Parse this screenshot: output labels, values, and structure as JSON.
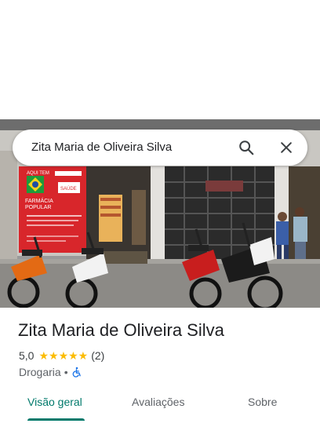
{
  "search": {
    "query": "Zita Maria de Oliveira Silva"
  },
  "place": {
    "name": "Zita Maria de Oliveira Silva",
    "rating": "5,0",
    "stars": "★★★★★",
    "review_count": "(2)",
    "category": "Drogaria",
    "separator": "•"
  },
  "photo_signs": {
    "line1": "AQUI TEM",
    "line2": "FARMÁCIA",
    "line3": "POPULAR",
    "badge": "SAÚDE"
  },
  "tabs": [
    {
      "label": "Visão geral",
      "active": true
    },
    {
      "label": "Avaliações",
      "active": false
    },
    {
      "label": "Sobre",
      "active": false
    }
  ],
  "colors": {
    "accent": "#00796b",
    "star": "#fbbc04",
    "accessibility": "#1a73e8"
  },
  "icons": {
    "search": "search-icon",
    "clear": "close-icon",
    "accessibility": "wheelchair-icon"
  }
}
